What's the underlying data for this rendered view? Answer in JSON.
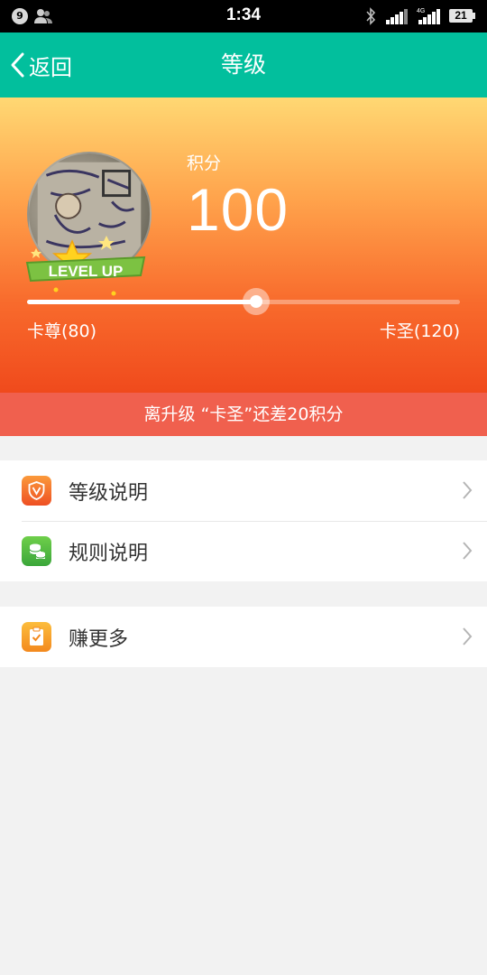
{
  "status_bar": {
    "notification_count": "9",
    "time": "1:34",
    "battery": "21"
  },
  "header": {
    "back_label": "返回",
    "title": "等级"
  },
  "hero": {
    "points_label": "积分",
    "points_value": "100",
    "badge_text": "LEVEL UP",
    "progress_fraction": 0.53,
    "current_level": "卡尊(80)",
    "next_level": "卡圣(120)"
  },
  "hint": "离升级 “卡圣”还差20积分",
  "menu": {
    "group1": [
      {
        "label": "等级说明",
        "icon": "shield-v-icon",
        "color": "#f05a28"
      },
      {
        "label": "规则说明",
        "icon": "coins-icon",
        "color": "#4cb848"
      }
    ],
    "group2": [
      {
        "label": "赚更多",
        "icon": "clipboard-check-icon",
        "color": "#f59a2a"
      }
    ]
  },
  "colors": {
    "header": "#02bf9d",
    "hint_bar": "#f0604e",
    "hero_top": "#ffd873",
    "hero_bottom": "#f04a1c"
  }
}
